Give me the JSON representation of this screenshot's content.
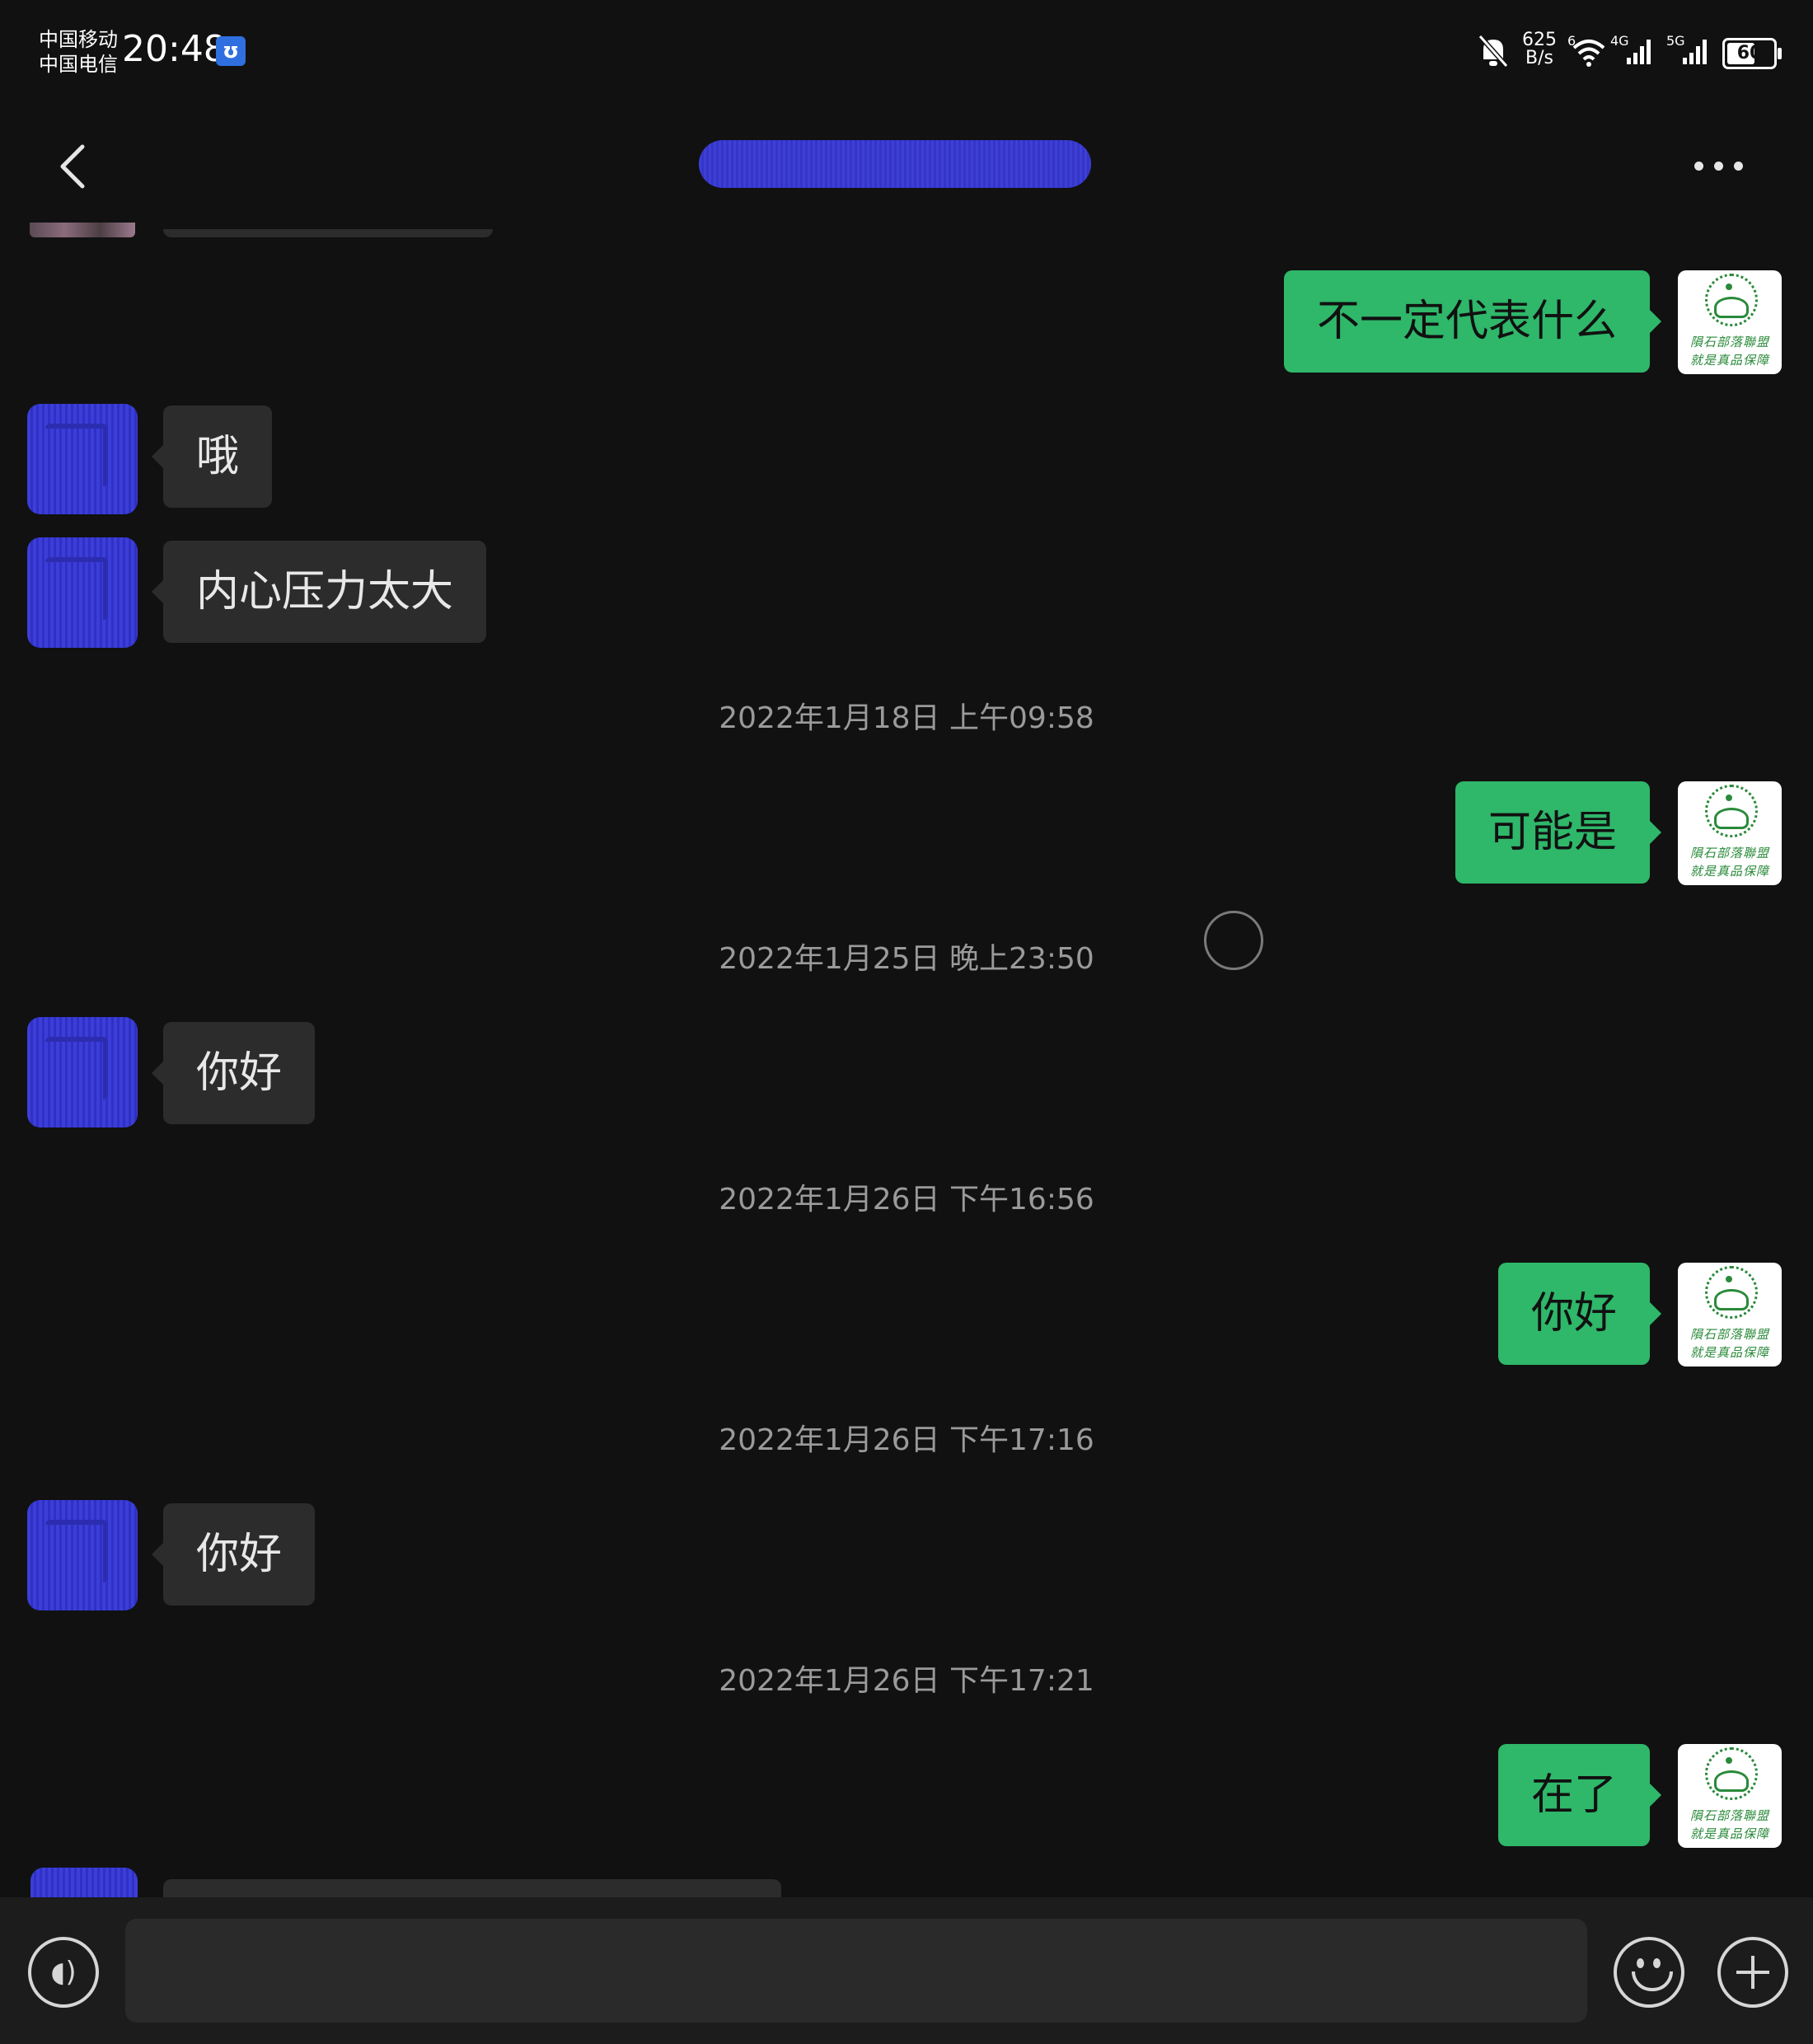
{
  "status_bar": {
    "carrier_1": "中国移动",
    "carrier_2": "中国电信",
    "time": "20:48",
    "net_speed_value": "625",
    "net_speed_unit": "B/s",
    "wifi_tag": "6",
    "net_1": "4G",
    "net_2": "5G",
    "battery": "60",
    "icons": [
      "silent-bell-icon",
      "wifi-icon",
      "signal-icon",
      "battery-icon"
    ]
  },
  "header": {
    "back_icon": "chevron-left-icon",
    "more_icon": "more-dots-icon"
  },
  "sent_avatar": {
    "line1": "隕石部落聯盟",
    "line2": "就是真品保障"
  },
  "messages": [
    {
      "type": "out",
      "text": "不一定代表什么"
    },
    {
      "type": "in",
      "text": "哦"
    },
    {
      "type": "in",
      "text": "内心压力太大"
    },
    {
      "type": "time",
      "text": "2022年1月18日 上午09:58"
    },
    {
      "type": "out",
      "text": "可能是"
    },
    {
      "type": "time",
      "text": "2022年1月25日 晚上23:50"
    },
    {
      "type": "in",
      "text": "你好"
    },
    {
      "type": "time",
      "text": "2022年1月26日 下午16:56"
    },
    {
      "type": "out",
      "text": "你好"
    },
    {
      "type": "time",
      "text": "2022年1月26日 下午17:16"
    },
    {
      "type": "in",
      "text": "你好"
    },
    {
      "type": "time",
      "text": "2022年1月26日 下午17:21"
    },
    {
      "type": "out",
      "text": "在了"
    }
  ],
  "input_bar": {
    "voice_icon": "voice-icon",
    "emoji_icon": "emoji-icon",
    "plus_icon": "plus-icon",
    "text_value": ""
  },
  "colors": {
    "background": "#111111",
    "sent_bubble": "#2fb76a",
    "received_bubble": "#2c2c2c",
    "timestamp": "#9a9a9a"
  }
}
